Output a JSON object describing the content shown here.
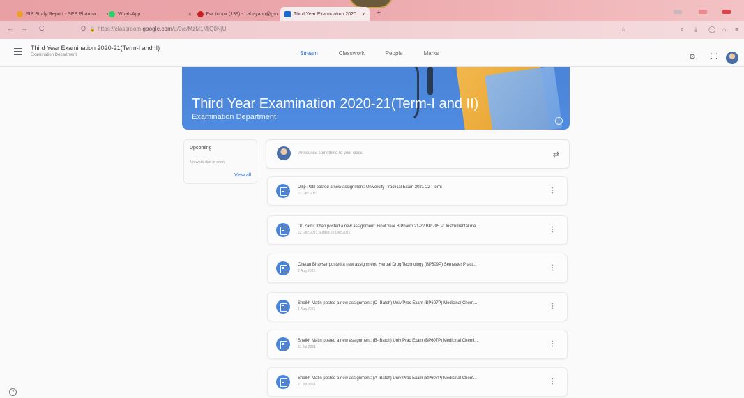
{
  "browser": {
    "tabs": [
      {
        "label": "SIP Study Report - SES Pharma",
        "color": "#f0a020"
      },
      {
        "label": "WhatsApp",
        "color": "#25d366"
      },
      {
        "label": "Fw: Inbox (139) - Lahayapp@gm",
        "color": "#c5221f"
      },
      {
        "label": "Third Year Examination 2020-21",
        "color": "#1967d2"
      }
    ],
    "tab_close": "×",
    "new_tab": "+",
    "url_prefix": "https://classroom.",
    "url_domain": "google.com",
    "url_path": "/u/0/c/MzM1MjQ0NjU"
  },
  "header": {
    "title": "Third Year Examination 2020-21(Term-I and II)",
    "subtitle": "Examination Department",
    "tabs": [
      "Stream",
      "Classwork",
      "People",
      "Marks"
    ],
    "active_tab": 0
  },
  "banner": {
    "title": "Third Year Examination 2020-21(Term-I and II)",
    "subtitle": "Examination Department",
    "info": "i"
  },
  "upcoming": {
    "heading": "Upcoming",
    "text": "No work due in soon",
    "view_all": "View all"
  },
  "announce": {
    "placeholder": "Announce something to your class"
  },
  "posts": [
    {
      "text": "Dilip Patil posted a new assignment: University Practical Exam 2021-22 I term",
      "date": "22 Dec 2021"
    },
    {
      "text": "Dr. Zamir Khan posted a new assignment: Final Year B Pharm 21-22 BP 705 P: Instrumental me...",
      "date": "22 Dec 2021 (Edited 22 Dec 2021)"
    },
    {
      "text": "Chetan Bhavsar posted a new assignment: Herbal Drug Technology (BP609P) Semester Pract...",
      "date": "2 Aug 2021"
    },
    {
      "text": "Shaikh Matin posted a new assignment: (C- Batch) Univ Prac Exam (BP607P) Medicinal Chem...",
      "date": "1 Aug 2021"
    },
    {
      "text": "Shaikh Matin posted a new assignment: (B- Batch) Univ Prac Exam (BP607P) Medicinal Chemi...",
      "date": "31 Jul 2021"
    },
    {
      "text": "Shaikh Matin posted a new assignment: (A- Batch) Univ Prac Exam (BP607P) Medicinal Chem...",
      "date": "21 Jul 2021"
    }
  ],
  "icons": {
    "back": "←",
    "forward": "→",
    "reload": "C",
    "shield": "O",
    "lock": "🔒",
    "star": "☆",
    "more": "⋮",
    "repost": "⇄",
    "settings": "⚙",
    "apps": "⋮⋮",
    "help": "?"
  }
}
